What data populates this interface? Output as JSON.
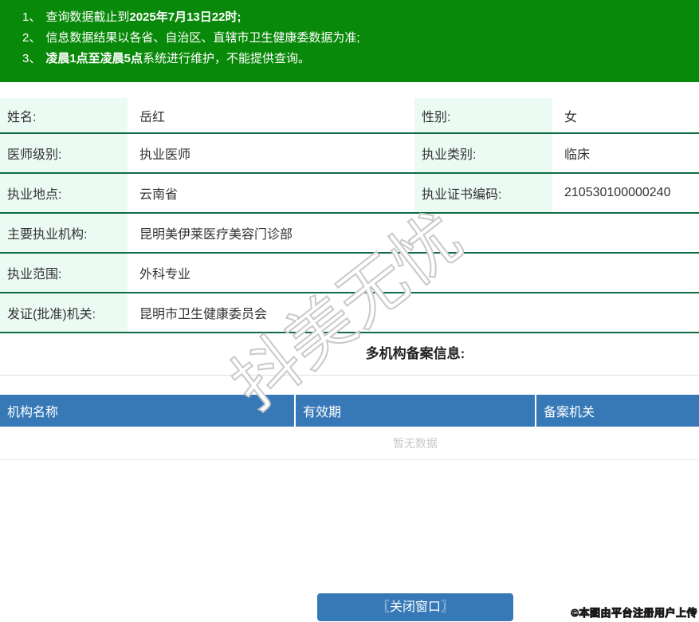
{
  "notices": {
    "items": [
      {
        "num": "1、",
        "pre": "查询数据截止到",
        "bold": "2025年7月13日22时;",
        "post": ""
      },
      {
        "num": "2、",
        "pre": "信息数据结果以各省、自治区、直辖市卫生健康委数据为准;",
        "bold": "",
        "post": ""
      },
      {
        "num": "3、",
        "pre": "",
        "bold": "凌晨1点至凌晨5点",
        "post": "系统进行维护，不能提供查询。"
      }
    ]
  },
  "info": {
    "rows": [
      {
        "label1": "姓名:",
        "value1": "岳红",
        "label2": "性别:",
        "value2": "女"
      },
      {
        "label1": "医师级别:",
        "value1": "执业医师",
        "label2": "执业类别:",
        "value2": "临床"
      },
      {
        "label1": "执业地点:",
        "value1": "云南省",
        "label2": "执业证书编码:",
        "value2": "210530100000240"
      },
      {
        "label1": "主要执业机构:",
        "value1": "昆明美伊莱医疗美容门诊部"
      },
      {
        "label1": "执业范围:",
        "value1": "外科专业"
      },
      {
        "label1": "发证(批准)机关:",
        "value1": "昆明市卫生健康委员会"
      }
    ]
  },
  "registration": {
    "title": "多机构备案信息:",
    "columns": [
      "机构名称",
      "有效期",
      "备案机关"
    ],
    "empty_text": "暂无数据"
  },
  "footer": {
    "close_button": "〖关闭窗口〗",
    "copyright": "©本图由平台注册用户上传"
  },
  "watermark": {
    "text": "抖美无忧"
  },
  "colors": {
    "notice_bg": "#098909",
    "table_border": "#0e6b45",
    "label_bg": "#ebfaf3",
    "table_header_bg": "#3779b7",
    "button_bg": "#3779b7",
    "empty_text": "#c8c8c8",
    "watermark_stroke": "#c9c9c9"
  }
}
